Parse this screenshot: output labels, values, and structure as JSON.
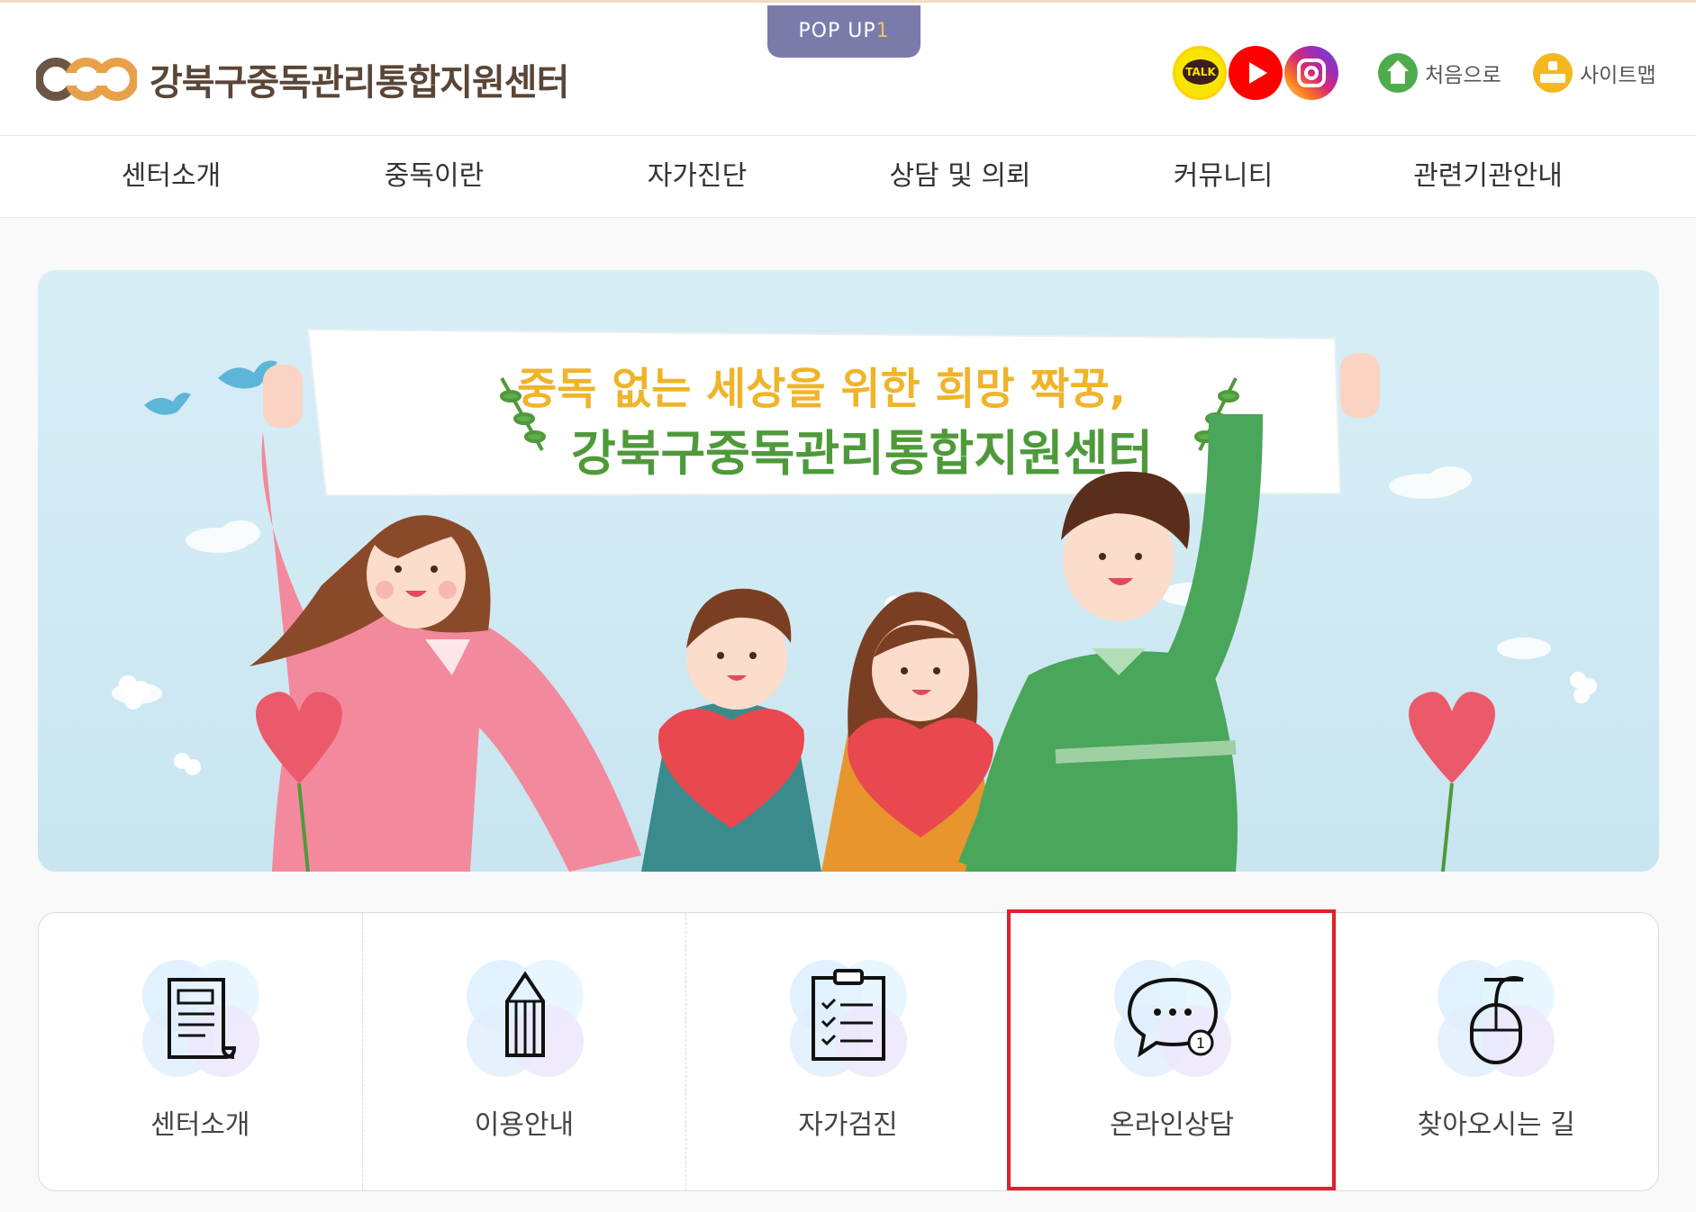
{
  "header": {
    "site_name": "강북구중독관리통합지원센터",
    "popup_tab": {
      "label": "POP UP",
      "count": "1"
    },
    "sns": [
      {
        "name": "kakao-talk-icon",
        "label": "TALK"
      },
      {
        "name": "youtube-icon"
      },
      {
        "name": "instagram-icon"
      }
    ],
    "home_label": "처음으로",
    "sitemap_label": "사이트맵"
  },
  "nav": {
    "items": [
      "센터소개",
      "중독이란",
      "자가진단",
      "상담 및 의뢰",
      "커뮤니티",
      "관련기관안내"
    ]
  },
  "banner": {
    "line1": "중독 없는 세상을 위한 희망 짝꿍,",
    "line2": "강북구중독관리통합지원센터"
  },
  "quick_menu": {
    "items": [
      {
        "label": "센터소개",
        "icon": "document-icon"
      },
      {
        "label": "이용안내",
        "icon": "pencil-icon"
      },
      {
        "label": "자가검진",
        "icon": "clipboard-checklist-icon"
      },
      {
        "label": "온라인상담",
        "icon": "chat-bubble-icon",
        "badge": "1",
        "highlighted": true
      },
      {
        "label": "찾아오시는 길",
        "icon": "mouse-icon"
      }
    ]
  },
  "colors": {
    "popup_tab": "#7b7bab",
    "highlight_border": "#e0202a",
    "logo_text": "#5a4638",
    "banner_line1": "#f0b42a",
    "banner_line2": "#4e9a3a"
  }
}
